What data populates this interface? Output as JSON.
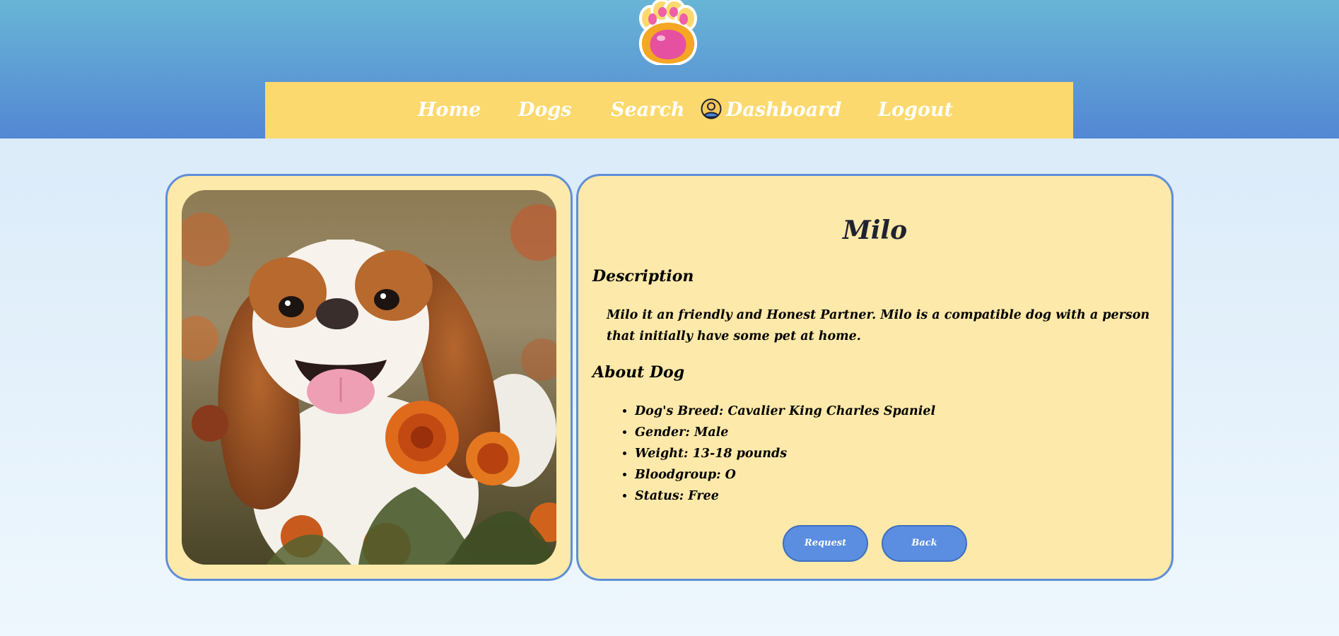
{
  "nav": {
    "home": "Home",
    "dogs": "Dogs",
    "search": "Search",
    "dashboard": "Dashboard",
    "logout": "Logout"
  },
  "dog": {
    "name": "Milo",
    "description_title": "Description",
    "description": "Milo it an friendly and Honest Partner. Milo is a compatible dog with a person that initially have some pet at home.",
    "about_title": "About Dog",
    "details": [
      "Dog's Breed: Cavalier King Charles Spaniel",
      "Gender: Male",
      "Weight: 13-18 pounds",
      "Bloodgroup: O",
      "Status: Free"
    ]
  },
  "actions": {
    "request": "Request",
    "back": "Back"
  },
  "colors": {
    "header_top": "#68b5d6",
    "header_bottom": "#5387d4",
    "nav_bg": "#fcd96e",
    "card_bg": "#fde9a9",
    "card_border": "#5f8ed8",
    "button_bg": "#5b8ee0"
  },
  "icons": {
    "logo": "paw-logo-icon",
    "user": "user-circle-icon"
  }
}
